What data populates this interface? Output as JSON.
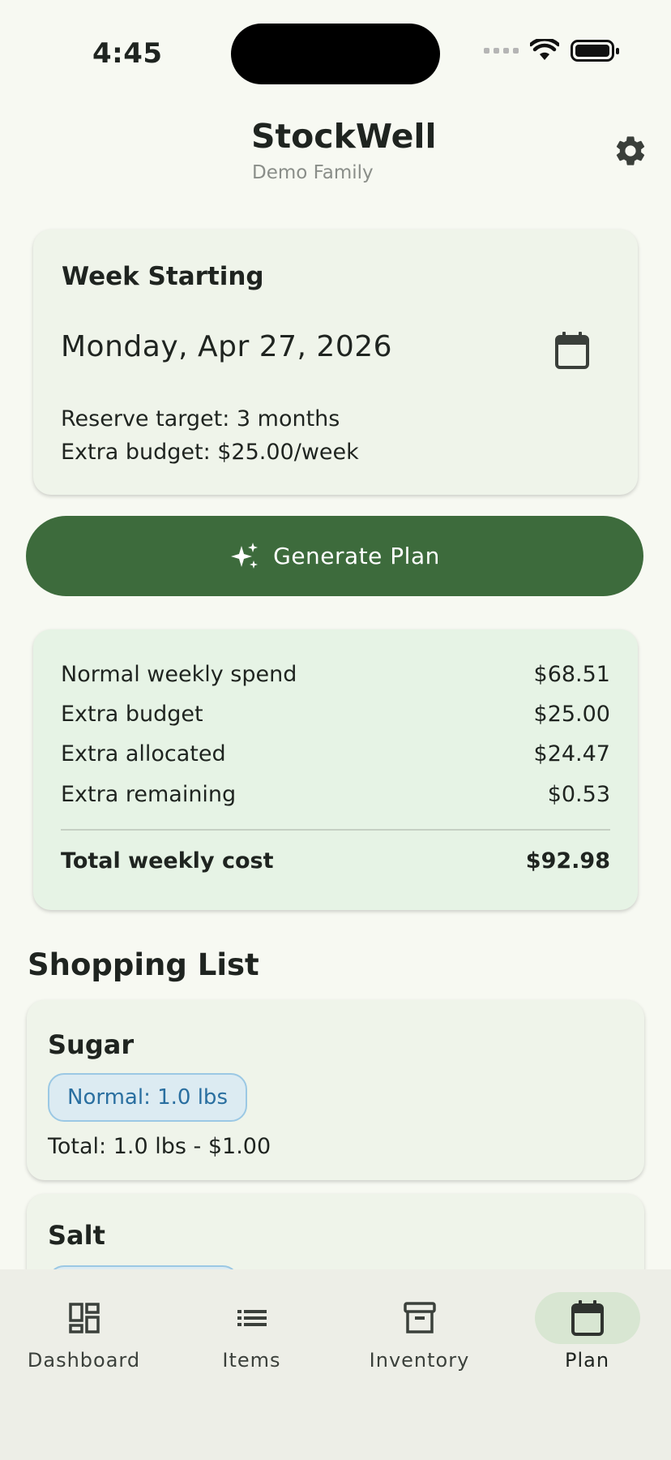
{
  "status": {
    "time": "4:45"
  },
  "header": {
    "title": "StockWell",
    "subtitle": "Demo Family"
  },
  "week": {
    "label": "Week Starting",
    "date": "Monday, Apr 27, 2026",
    "reserve_target": "Reserve target: 3 months",
    "extra_budget": "Extra budget: $25.00/week"
  },
  "generate_button": {
    "label": "Generate Plan"
  },
  "summary": {
    "rows": [
      {
        "label": "Normal weekly spend",
        "value": "$68.51"
      },
      {
        "label": "Extra budget",
        "value": "$25.00"
      },
      {
        "label": "Extra allocated",
        "value": "$24.47"
      },
      {
        "label": "Extra remaining",
        "value": "$0.53"
      }
    ],
    "total": {
      "label": "Total weekly cost",
      "value": "$92.98"
    }
  },
  "shopping_list": {
    "title": "Shopping List",
    "items": [
      {
        "name": "Sugar",
        "chip": "Normal: 1.0 lbs",
        "total": "Total: 1.0 lbs - $1.00"
      },
      {
        "name": "Salt"
      }
    ]
  },
  "nav": {
    "items": [
      {
        "label": "Dashboard",
        "icon": "dashboard-icon"
      },
      {
        "label": "Items",
        "icon": "list-icon"
      },
      {
        "label": "Inventory",
        "icon": "archive-box-icon"
      },
      {
        "label": "Plan",
        "icon": "calendar-icon",
        "active": true
      }
    ]
  },
  "colors": {
    "primary": "#3d6b3c",
    "background": "#f7f9f2",
    "chip_text": "#2a6fa0"
  }
}
